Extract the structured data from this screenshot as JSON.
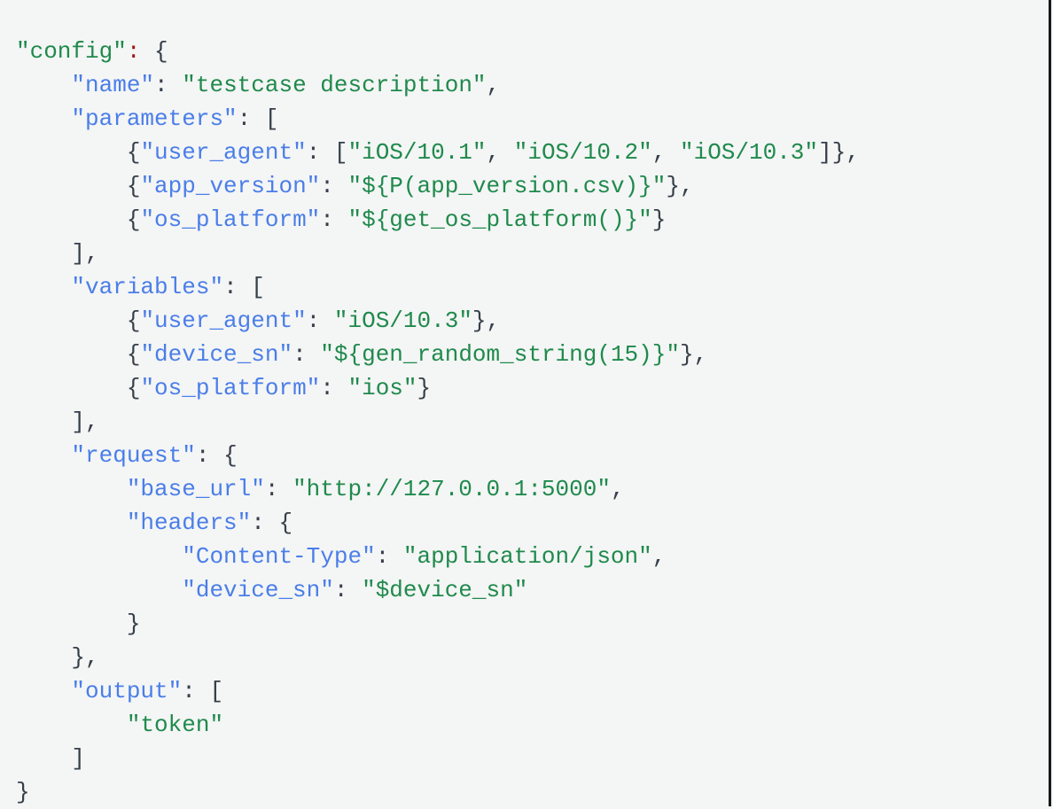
{
  "document": {
    "kind": "code-snippet",
    "language": "json",
    "indent_size": 4,
    "line_count": 23
  },
  "theme": {
    "background": "#f4f5f5",
    "punctuation": "#36404a",
    "key": "#4a7ee8",
    "root_key": "#1f8a4c",
    "root_colon": "#a01818",
    "string": "#1f8a4c",
    "edge_border": "#17191c"
  },
  "config_object": {
    "name": "testcase description",
    "parameters": [
      {
        "user_agent": [
          "iOS/10.1",
          "iOS/10.2",
          "iOS/10.3"
        ]
      },
      {
        "app_version": "${P(app_version.csv)}"
      },
      {
        "os_platform": "${get_os_platform()}"
      }
    ],
    "variables": [
      {
        "user_agent": "iOS/10.3"
      },
      {
        "device_sn": "${gen_random_string(15)}"
      },
      {
        "os_platform": "ios"
      }
    ],
    "request": {
      "base_url": "http://127.0.0.1:5000",
      "headers": {
        "Content-Type": "application/json",
        "device_sn": "$device_sn"
      }
    },
    "output": [
      "token"
    ]
  },
  "lines": [
    {
      "n": 1,
      "indent": 0,
      "text": "\"config\": {",
      "tokens": [
        {
          "t": "\"config\"",
          "c": "tok-rootkey"
        },
        {
          "t": ":",
          "c": "tok-rootcolon"
        },
        {
          "t": " {",
          "c": "tok-punct"
        }
      ]
    },
    {
      "n": 2,
      "indent": 4,
      "text": "\"name\": \"testcase description\",",
      "tokens": [
        {
          "t": "\"name\"",
          "c": "tok-key"
        },
        {
          "t": ": ",
          "c": "tok-punct"
        },
        {
          "t": "\"testcase description\"",
          "c": "tok-str"
        },
        {
          "t": ",",
          "c": "tok-punct"
        }
      ]
    },
    {
      "n": 3,
      "indent": 4,
      "text": "\"parameters\": [",
      "tokens": [
        {
          "t": "\"parameters\"",
          "c": "tok-key"
        },
        {
          "t": ": [",
          "c": "tok-punct"
        }
      ]
    },
    {
      "n": 4,
      "indent": 8,
      "text": "{\"user_agent\": [\"iOS/10.1\", \"iOS/10.2\", \"iOS/10.3\"]},",
      "tokens": [
        {
          "t": "{",
          "c": "tok-punct"
        },
        {
          "t": "\"user_agent\"",
          "c": "tok-key"
        },
        {
          "t": ": [",
          "c": "tok-punct"
        },
        {
          "t": "\"iOS/10.1\"",
          "c": "tok-str"
        },
        {
          "t": ", ",
          "c": "tok-punct"
        },
        {
          "t": "\"iOS/10.2\"",
          "c": "tok-str"
        },
        {
          "t": ", ",
          "c": "tok-punct"
        },
        {
          "t": "\"iOS/10.3\"",
          "c": "tok-str"
        },
        {
          "t": "]},",
          "c": "tok-punct"
        }
      ]
    },
    {
      "n": 5,
      "indent": 8,
      "text": "{\"app_version\": \"${P(app_version.csv)}\"},",
      "tokens": [
        {
          "t": "{",
          "c": "tok-punct"
        },
        {
          "t": "\"app_version\"",
          "c": "tok-key"
        },
        {
          "t": ": ",
          "c": "tok-punct"
        },
        {
          "t": "\"${P(app_version.csv)}\"",
          "c": "tok-str"
        },
        {
          "t": "},",
          "c": "tok-punct"
        }
      ]
    },
    {
      "n": 6,
      "indent": 8,
      "text": "{\"os_platform\": \"${get_os_platform()}\"}",
      "tokens": [
        {
          "t": "{",
          "c": "tok-punct"
        },
        {
          "t": "\"os_platform\"",
          "c": "tok-key"
        },
        {
          "t": ": ",
          "c": "tok-punct"
        },
        {
          "t": "\"${get_os_platform()}\"",
          "c": "tok-str"
        },
        {
          "t": "}",
          "c": "tok-punct"
        }
      ]
    },
    {
      "n": 7,
      "indent": 4,
      "text": "],",
      "tokens": [
        {
          "t": "],",
          "c": "tok-punct"
        }
      ]
    },
    {
      "n": 8,
      "indent": 4,
      "text": "\"variables\": [",
      "tokens": [
        {
          "t": "\"variables\"",
          "c": "tok-key"
        },
        {
          "t": ": [",
          "c": "tok-punct"
        }
      ]
    },
    {
      "n": 9,
      "indent": 8,
      "text": "{\"user_agent\": \"iOS/10.3\"},",
      "tokens": [
        {
          "t": "{",
          "c": "tok-punct"
        },
        {
          "t": "\"user_agent\"",
          "c": "tok-key"
        },
        {
          "t": ": ",
          "c": "tok-punct"
        },
        {
          "t": "\"iOS/10.3\"",
          "c": "tok-str"
        },
        {
          "t": "},",
          "c": "tok-punct"
        }
      ]
    },
    {
      "n": 10,
      "indent": 8,
      "text": "{\"device_sn\": \"${gen_random_string(15)}\"},",
      "tokens": [
        {
          "t": "{",
          "c": "tok-punct"
        },
        {
          "t": "\"device_sn\"",
          "c": "tok-key"
        },
        {
          "t": ": ",
          "c": "tok-punct"
        },
        {
          "t": "\"${gen_random_string(15)}\"",
          "c": "tok-str"
        },
        {
          "t": "},",
          "c": "tok-punct"
        }
      ]
    },
    {
      "n": 11,
      "indent": 8,
      "text": "{\"os_platform\": \"ios\"}",
      "tokens": [
        {
          "t": "{",
          "c": "tok-punct"
        },
        {
          "t": "\"os_platform\"",
          "c": "tok-key"
        },
        {
          "t": ": ",
          "c": "tok-punct"
        },
        {
          "t": "\"ios\"",
          "c": "tok-str"
        },
        {
          "t": "}",
          "c": "tok-punct"
        }
      ]
    },
    {
      "n": 12,
      "indent": 4,
      "text": "],",
      "tokens": [
        {
          "t": "],",
          "c": "tok-punct"
        }
      ]
    },
    {
      "n": 13,
      "indent": 4,
      "text": "\"request\": {",
      "tokens": [
        {
          "t": "\"request\"",
          "c": "tok-key"
        },
        {
          "t": ": {",
          "c": "tok-punct"
        }
      ]
    },
    {
      "n": 14,
      "indent": 8,
      "text": "\"base_url\": \"http://127.0.0.1:5000\",",
      "tokens": [
        {
          "t": "\"base_url\"",
          "c": "tok-key"
        },
        {
          "t": ": ",
          "c": "tok-punct"
        },
        {
          "t": "\"http://127.0.0.1:5000\"",
          "c": "tok-str"
        },
        {
          "t": ",",
          "c": "tok-punct"
        }
      ]
    },
    {
      "n": 15,
      "indent": 8,
      "text": "\"headers\": {",
      "tokens": [
        {
          "t": "\"headers\"",
          "c": "tok-key"
        },
        {
          "t": ": {",
          "c": "tok-punct"
        }
      ]
    },
    {
      "n": 16,
      "indent": 12,
      "text": "\"Content-Type\": \"application/json\",",
      "tokens": [
        {
          "t": "\"Content-Type\"",
          "c": "tok-key"
        },
        {
          "t": ": ",
          "c": "tok-punct"
        },
        {
          "t": "\"application/json\"",
          "c": "tok-str"
        },
        {
          "t": ",",
          "c": "tok-punct"
        }
      ]
    },
    {
      "n": 17,
      "indent": 12,
      "text": "\"device_sn\": \"$device_sn\"",
      "tokens": [
        {
          "t": "\"device_sn\"",
          "c": "tok-key"
        },
        {
          "t": ": ",
          "c": "tok-punct"
        },
        {
          "t": "\"$device_sn\"",
          "c": "tok-str"
        }
      ]
    },
    {
      "n": 18,
      "indent": 8,
      "text": "}",
      "tokens": [
        {
          "t": "}",
          "c": "tok-punct"
        }
      ]
    },
    {
      "n": 19,
      "indent": 4,
      "text": "},",
      "tokens": [
        {
          "t": "},",
          "c": "tok-punct"
        }
      ]
    },
    {
      "n": 20,
      "indent": 4,
      "text": "\"output\": [",
      "tokens": [
        {
          "t": "\"output\"",
          "c": "tok-key"
        },
        {
          "t": ": [",
          "c": "tok-punct"
        }
      ]
    },
    {
      "n": 21,
      "indent": 8,
      "text": "\"token\"",
      "tokens": [
        {
          "t": "\"token\"",
          "c": "tok-str"
        }
      ]
    },
    {
      "n": 22,
      "indent": 4,
      "text": "]",
      "tokens": [
        {
          "t": "]",
          "c": "tok-punct"
        }
      ]
    },
    {
      "n": 23,
      "indent": 0,
      "text": "}",
      "tokens": [
        {
          "t": "}",
          "c": "tok-punct"
        }
      ]
    }
  ]
}
